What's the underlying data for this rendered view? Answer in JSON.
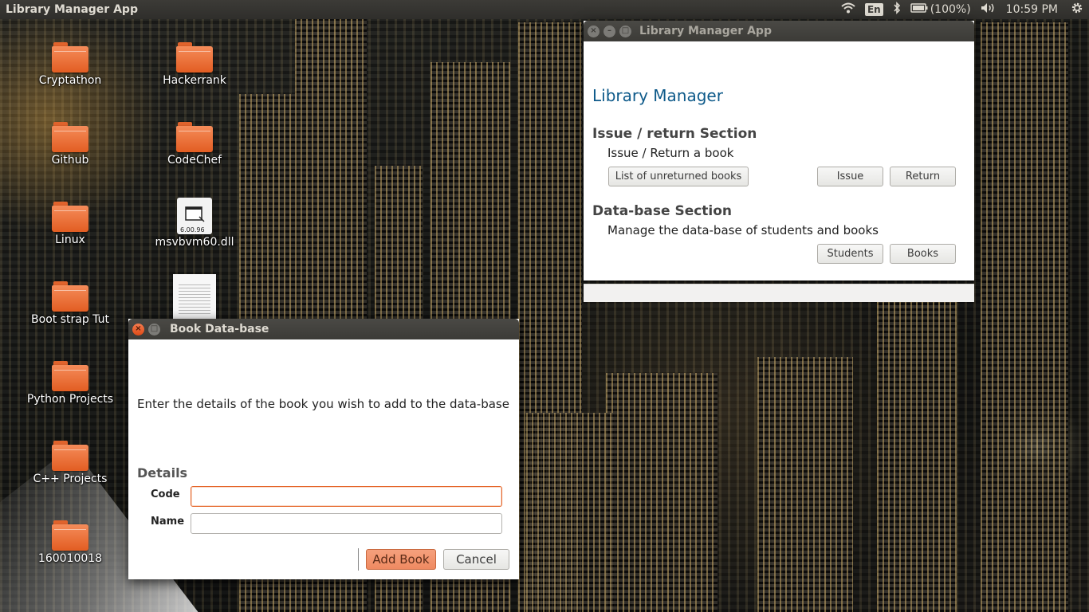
{
  "top_panel": {
    "app_title": "Library Manager App",
    "language": "En",
    "battery": "(100%)",
    "clock": "10:59 PM"
  },
  "desktop_icons": [
    {
      "label": "Cryptathon",
      "type": "folder"
    },
    {
      "label": "Hackerrank",
      "type": "folder"
    },
    {
      "label": "Github",
      "type": "folder"
    },
    {
      "label": "CodeChef",
      "type": "folder"
    },
    {
      "label": "Linux",
      "type": "folder"
    },
    {
      "label": "msvbvm60.dll",
      "type": "file",
      "badge": "6.00.96"
    },
    {
      "label": "Boot strap Tut",
      "type": "folder"
    },
    {
      "label": "Python Projects",
      "type": "folder"
    },
    {
      "label": "C++ Projects",
      "type": "folder"
    },
    {
      "label": "160010018",
      "type": "folder"
    }
  ],
  "main_window": {
    "title": "Library Manager App",
    "heading": "Library Manager",
    "issue_section": {
      "title": "Issue / return Section",
      "subtitle": "Issue / Return a book",
      "list_button": "List of unreturned books",
      "issue_button": "Issue",
      "return_button": "Return"
    },
    "db_section": {
      "title": "Data-base Section",
      "subtitle": "Manage the data-base of students and books",
      "students_button": "Students",
      "books_button": "Books"
    }
  },
  "dialog": {
    "title": "Book Data-base",
    "prompt": "Enter the details of the book you wish to add to the data-base",
    "details_heading": "Details",
    "code_label": "Code",
    "code_value": "",
    "name_label": "Name",
    "name_value": "",
    "add_button": "Add Book",
    "cancel_button": "Cancel"
  },
  "colors": {
    "accent": "#e5662a",
    "heading_blue": "#0e5a8a",
    "panel": "#3c3b37"
  }
}
